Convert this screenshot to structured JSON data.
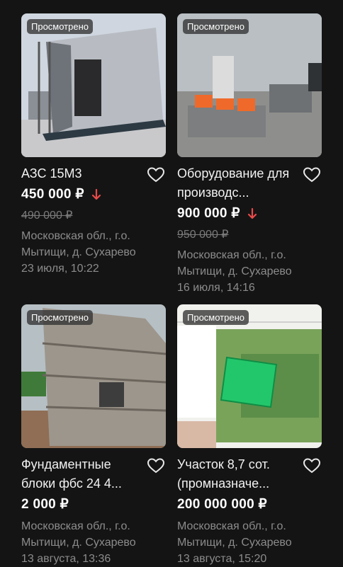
{
  "colors": {
    "background": "#141414",
    "price_drop": "#e84a4a",
    "muted": "#8c8c8c"
  },
  "listings": [
    {
      "badge": "Просмотрено",
      "title": "АЗС 15М3",
      "price": "450 000 ₽",
      "old_price": "490 000 ₽",
      "location": "Московская обл., г.о. Мытищи, д. Сухарево",
      "date": "23 июля, 10:22",
      "price_drop": true
    },
    {
      "badge": "Просмотрено",
      "title": "Оборудование для производс...",
      "price": "900 000 ₽",
      "old_price": "950 000 ₽",
      "location": "Московская обл., г.о. Мытищи, д. Сухарево",
      "date": "16 июля, 14:16",
      "price_drop": true
    },
    {
      "badge": "Просмотрено",
      "title": "Фундаментные блоки фбс 24 4...",
      "price": "2 000 ₽",
      "location": "Московская обл., г.о. Мытищи, д. Сухарево",
      "date": "13 августа, 13:36",
      "price_drop": false
    },
    {
      "badge": "Просмотрено",
      "title": "Участок 8,7 сот. (промназначе...",
      "price": "200 000 000 ₽",
      "location": "Московская обл., г.о. Мытищи, д. Сухарево",
      "date": "13 августа, 15:20",
      "price_drop": false
    }
  ]
}
